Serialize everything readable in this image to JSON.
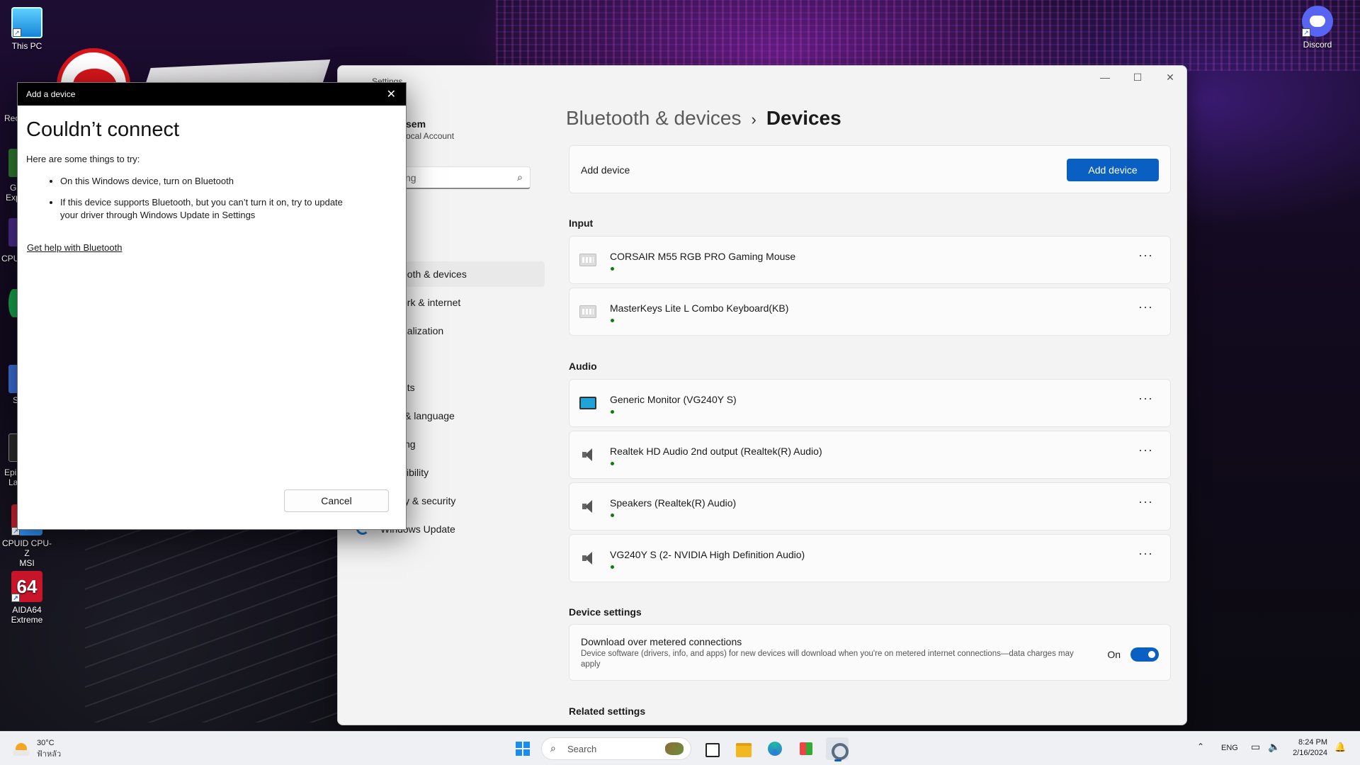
{
  "desktop": {
    "icons": {
      "this_pc": "This PC",
      "cpuz_line1": "CPUID CPU-Z",
      "cpuz_line2": "MSI",
      "aida_line1": "AIDA64",
      "aida_line2": "Extreme",
      "aida_glyph": "64",
      "discord": "Discord"
    },
    "partial_labels": {
      "recycle": "Rec",
      "geforce_1": "G",
      "geforce_2": "Exp",
      "cpu": "CPU",
      "s": "S",
      "epic_1": "Epi",
      "epic_2": "La"
    }
  },
  "settings": {
    "app_title": "Settings",
    "user_name": "sem",
    "user_account": "ocal Account",
    "search_placeholder": "ng",
    "nav": [
      {
        "label": "n"
      },
      {
        "label": "ooth & devices"
      },
      {
        "label": "ork & internet"
      },
      {
        "label": "nalization"
      },
      {
        "label": "nts"
      },
      {
        "label": "& language"
      },
      {
        "label": "ng"
      },
      {
        "label": "sibility"
      },
      {
        "label": "y & security"
      },
      {
        "label": "Windows Update"
      }
    ],
    "breadcrumb": {
      "parent": "Bluetooth & devices",
      "separator": "›",
      "current": "Devices"
    },
    "add_card": {
      "label": "Add device",
      "button": "Add device"
    },
    "input_section": "Input",
    "input_devices": [
      {
        "name": "CORSAIR M55 RGB PRO Gaming Mouse",
        "icon": "keyboard-icon"
      },
      {
        "name": "MasterKeys Lite L Combo Keyboard(KB)",
        "icon": "keyboard-icon"
      }
    ],
    "audio_section": "Audio",
    "audio_devices": [
      {
        "name": "Generic Monitor (VG240Y S)",
        "icon": "monitor-icon"
      },
      {
        "name": "Realtek HD Audio 2nd output (Realtek(R) Audio)",
        "icon": "speaker-icon"
      },
      {
        "name": "Speakers (Realtek(R) Audio)",
        "icon": "speaker-icon"
      },
      {
        "name": "VG240Y S (2- NVIDIA High Definition Audio)",
        "icon": "speaker-icon"
      }
    ],
    "more_glyph": "···",
    "device_settings_section": "Device settings",
    "metered": {
      "title": "Download over metered connections",
      "description": "Device software (drivers, info, and apps) for new devices will download when you're on metered internet connections—data charges may apply",
      "state": "On",
      "enabled": true
    },
    "related_section": "Related settings"
  },
  "dialog": {
    "window_title": "Add a device",
    "heading": "Couldn’t connect",
    "intro": "Here are some things to try:",
    "tips": [
      "On this Windows device, turn on Bluetooth",
      "If this device supports Bluetooth, but you can’t turn it on, try to update your driver through Windows Update in Settings"
    ],
    "help_link": "Get help with Bluetooth",
    "cancel": "Cancel"
  },
  "taskbar": {
    "weather_temp": "30°C",
    "weather_desc": "ฟ้าหลัว",
    "search_placeholder": "Search",
    "language": "ENG",
    "time": "8:24 PM",
    "date": "2/16/2024"
  },
  "colors": {
    "accent": "#0a5fc2",
    "status_connected": "#0f7b0f",
    "dialog_titlebar": "#000000"
  }
}
